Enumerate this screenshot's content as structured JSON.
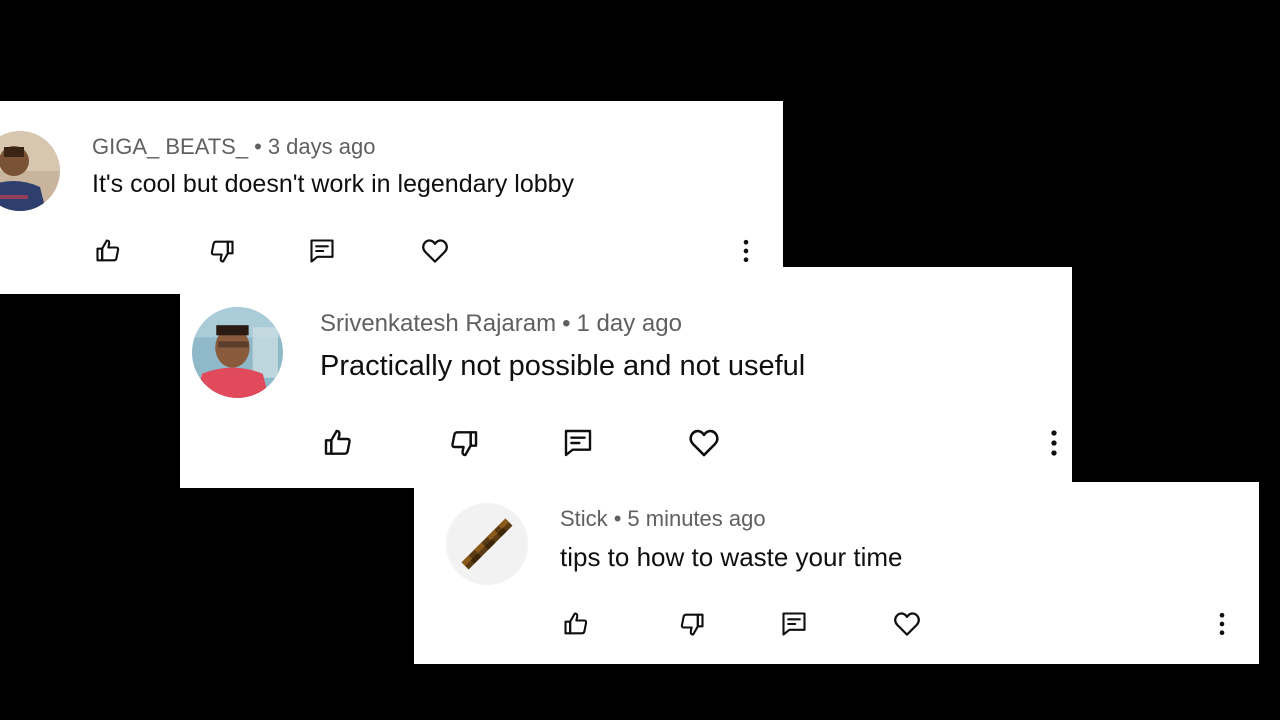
{
  "comments": [
    {
      "author": "GIGA_ BEATS_",
      "separator": "•",
      "time": "3 days ago",
      "text": "It's cool but doesn't work in legendary lobby",
      "avatar": "user-photo"
    },
    {
      "author": "Srivenkatesh Rajaram",
      "separator": "•",
      "time": "1 day ago",
      "text": "Practically not possible and not useful",
      "avatar": "user-photo"
    },
    {
      "author": "Stick",
      "separator": "•",
      "time": "5 minutes ago",
      "text": "tips to how to waste your time",
      "avatar": "minecraft-stick"
    }
  ],
  "actions": [
    "like-icon",
    "dislike-icon",
    "reply-icon",
    "heart-icon",
    "more-options-icon"
  ],
  "colors": {
    "background": "#000000",
    "card": "#ffffff",
    "meta_text": "#606060",
    "body_text": "#0f0f0f"
  }
}
